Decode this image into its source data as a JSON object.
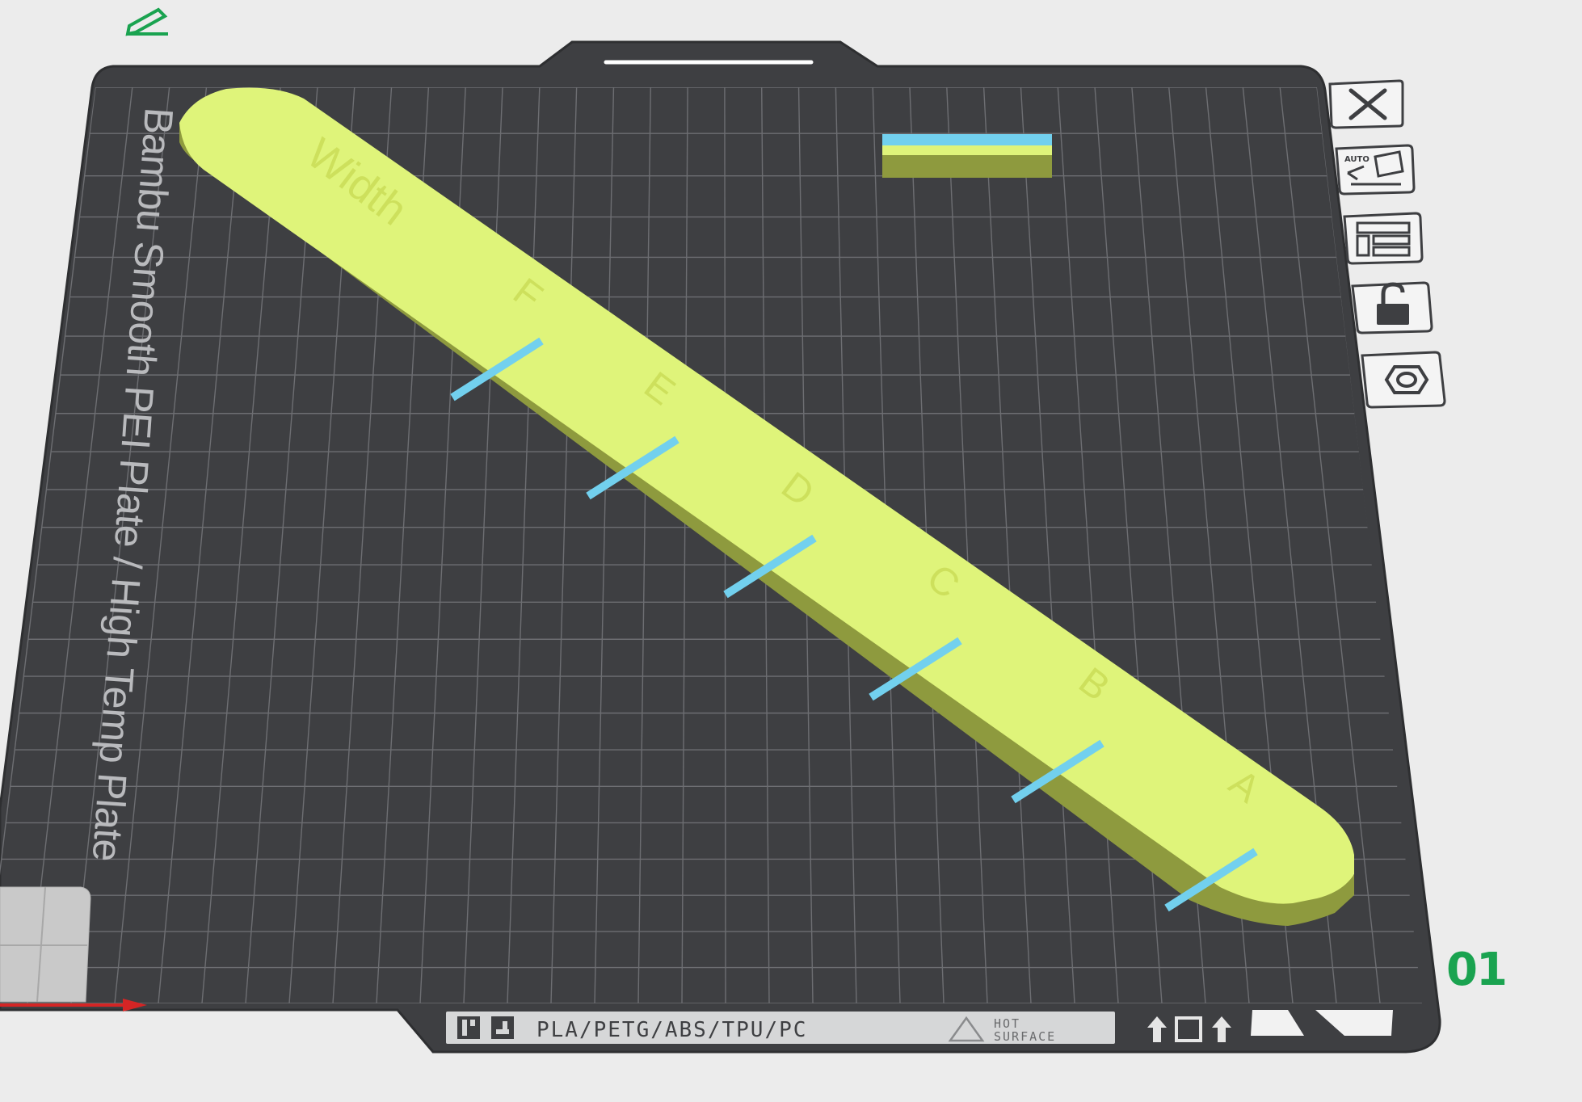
{
  "plate": {
    "name": "Bambu Smooth PEI Plate / High Temp Plate",
    "number": "01",
    "materials": "PLA/PETG/ABS/TPU/PC",
    "warning_line1": "HOT",
    "warning_line2": "SURFACE"
  },
  "toolbar": {
    "close_icon": "close-icon",
    "auto_orient_label": "AUTO",
    "arrange_icon": "arrange-icon",
    "lock_icon": "unlock-icon",
    "settings_icon": "plate-settings-icon"
  },
  "model": {
    "title": "Width",
    "labels": [
      "F",
      "E",
      "D",
      "C",
      "B",
      "A"
    ]
  },
  "colors": {
    "bed": "#3e3f42",
    "grid": "#6d6e72",
    "model_top": "#dff47a",
    "model_side": "#8e9a3e",
    "stripe": "#72d0ee",
    "plate_number": "#1aa350",
    "edit_icon": "#1aa350",
    "axis_x": "#d42525"
  }
}
